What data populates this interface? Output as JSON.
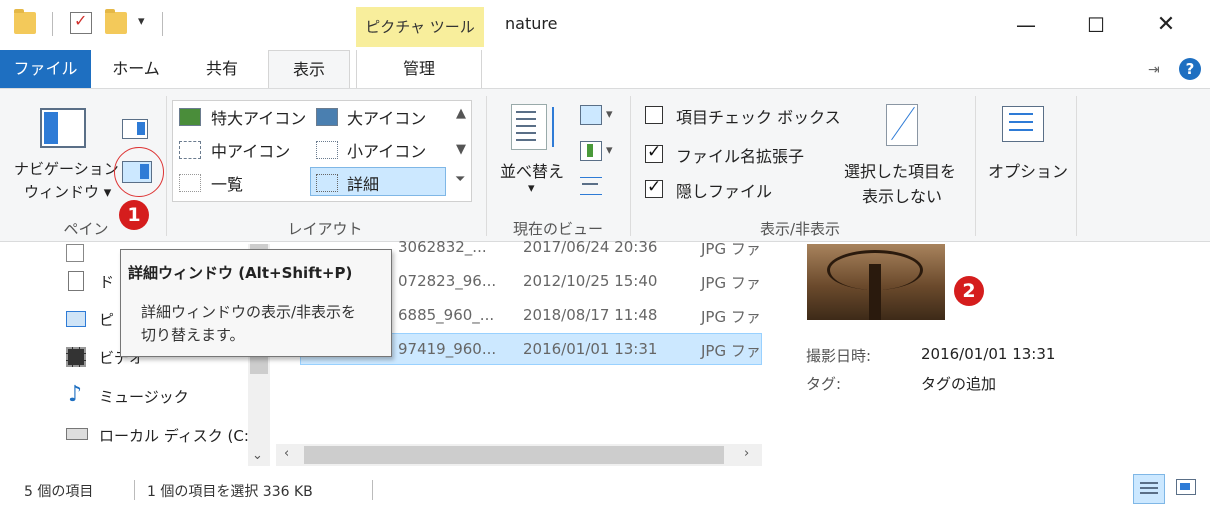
{
  "window": {
    "title": "nature",
    "context_tab": "ピクチャ ツール",
    "minimize_glyph": "—",
    "maximize_glyph": "☐",
    "close_glyph": "✕"
  },
  "tabs": [
    {
      "label": "ファイル",
      "active": false
    },
    {
      "label": "ホーム",
      "active": false
    },
    {
      "label": "共有",
      "active": false
    },
    {
      "label": "表示",
      "active": true
    },
    {
      "label": "管理",
      "active": false
    }
  ],
  "ribbon": {
    "pane": {
      "nav_pane_label_line1": "ナビゲーション",
      "nav_pane_label_line2": "ウィンドウ ▾",
      "group_label": "ペイン"
    },
    "layout": {
      "items": [
        "特大アイコン",
        "大アイコン",
        "中アイコン",
        "小アイコン",
        "一覧",
        "詳細"
      ],
      "selected": "詳細",
      "group_label": "レイアウト"
    },
    "current_view": {
      "sort_label_line1": "並べ替え",
      "sort_label_line2": "▾",
      "group_label": "現在のビュー"
    },
    "show_hide": {
      "checkboxes": [
        {
          "label": "項目チェック ボックス",
          "checked": false
        },
        {
          "label": "ファイル名拡張子",
          "checked": true
        },
        {
          "label": "隠しファイル",
          "checked": true
        }
      ],
      "hide_selected_line1": "選択した項目を",
      "hide_selected_line2": "表示しない",
      "group_label": "表示/非表示"
    },
    "options": {
      "label": "オプション"
    }
  },
  "nav_pane": {
    "items": [
      {
        "label": "ド",
        "icon": "document-icon"
      },
      {
        "label": "ピ",
        "icon": "picture-icon"
      },
      {
        "label": "ビデオ",
        "icon": "video-icon"
      },
      {
        "label": "ミュージック",
        "icon": "music-icon"
      },
      {
        "label": "ローカル ディスク (C:",
        "icon": "drive-icon"
      }
    ]
  },
  "files": [
    {
      "name": "3062832_...",
      "date": "2017/06/24 20:36",
      "type": "JPG ファ"
    },
    {
      "name": "072823_96...",
      "date": "2012/10/25 15:40",
      "type": "JPG ファ"
    },
    {
      "name": "6885_960_...",
      "date": "2018/08/17 11:48",
      "type": "JPG ファ"
    },
    {
      "name": "97419_960...",
      "date": "2016/01/01 13:31",
      "type": "JPG ファ",
      "selected": true
    }
  ],
  "tooltip": {
    "title": "詳細ウィンドウ (Alt+Shift+P)",
    "line1": "詳細ウィンドウの表示/非表示を",
    "line2": "切り替えます。"
  },
  "details_pane": {
    "rows": [
      {
        "label": "撮影日時:",
        "value": "2016/01/01 13:31"
      },
      {
        "label": "タグ:",
        "value": "タグの追加"
      }
    ]
  },
  "badges": {
    "one": "1",
    "two": "2"
  },
  "status": {
    "item_count": "5 個の項目",
    "selected": "1 個の項目を選択  336 KB"
  },
  "colors": {
    "file_tab": "#1e6fc1",
    "context_tab": "#f8ee9c",
    "selection": "#cce8ff",
    "badge": "#d51d1d",
    "help": "#1e6fc1"
  }
}
